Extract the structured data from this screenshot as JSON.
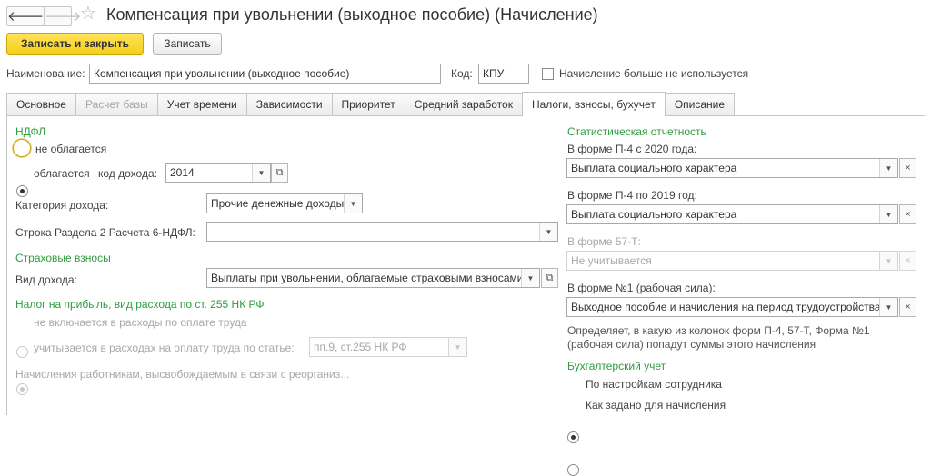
{
  "window": {
    "title": "Компенсация при увольнении (выходное пособие) (Начисление)",
    "back_glyph": "🡐",
    "forward_glyph": "🡒",
    "star_glyph": "☆"
  },
  "toolbar": {
    "save_close_label": "Записать и закрыть",
    "save_label": "Записать"
  },
  "header": {
    "name_label": "Наименование:",
    "name_value": "Компенсация при увольнении (выходное пособие)",
    "code_label": "Код:",
    "code_value": "КПУ",
    "unused_label": "Начисление больше не используется"
  },
  "tabs": [
    {
      "label": "Основное"
    },
    {
      "label": "Расчет базы"
    },
    {
      "label": "Учет времени"
    },
    {
      "label": "Зависимости"
    },
    {
      "label": "Приоритет"
    },
    {
      "label": "Средний заработок"
    },
    {
      "label": "Налоги, взносы, бухучет"
    },
    {
      "label": "Описание"
    }
  ],
  "ndfl": {
    "section_title": "НДФЛ",
    "not_taxed_label": "не облагается",
    "taxed_label": "облагается",
    "income_code_label": "код дохода:",
    "income_code_value": "2014",
    "category_label": "Категория дохода:",
    "category_value": "Прочие денежные доходы",
    "row_6ndfl_label": "Строка Раздела 2 Расчета 6-НДФЛ:",
    "row_6ndfl_value": ""
  },
  "insurance": {
    "section_title": "Страховые взносы",
    "income_type_label": "Вид дохода:",
    "income_type_value": "Выплаты при увольнении, облагаемые страховыми взносами"
  },
  "profit_tax": {
    "section_title": "Налог на прибыль, вид расхода по ст. 255 НК РФ",
    "not_included_label": "не включается в расходы по оплате труда",
    "included_label": "учитывается в расходах на оплату труда по статье:",
    "article_value": "пп.9, ст.255 НК РФ",
    "description": "Начисления работникам, высвобождаемым в связи с реорганиз..."
  },
  "statistics": {
    "section_title": "Статистическая отчетность",
    "p4_2020_label": "В форме П-4 с 2020 года:",
    "p4_2020_value": "Выплата социального характера",
    "p4_2019_label": "В форме П-4 по 2019 год:",
    "p4_2019_value": "Выплата социального характера",
    "f57t_label": "В форме 57-Т:",
    "f57t_value": "Не учитывается",
    "f1_label": "В форме №1 (рабочая сила):",
    "f1_value": "Выходное пособие и начисления на период трудоустройства",
    "note": "Определяет, в какую из колонок форм П-4, 57-Т, Форма №1 (рабочая сила) попадут суммы этого начисления"
  },
  "accounting": {
    "section_title": "Бухгалтерский учет",
    "by_employee_label": "По настройкам сотрудника",
    "as_set_label": "Как задано для начисления"
  },
  "glyphs": {
    "dropdown": "▼",
    "open": "⧉",
    "clear": "×"
  },
  "colors": {
    "section_green": "#2e9c3f",
    "primary_button": "#f5cf1c",
    "focus_ring": "#c9a420"
  }
}
